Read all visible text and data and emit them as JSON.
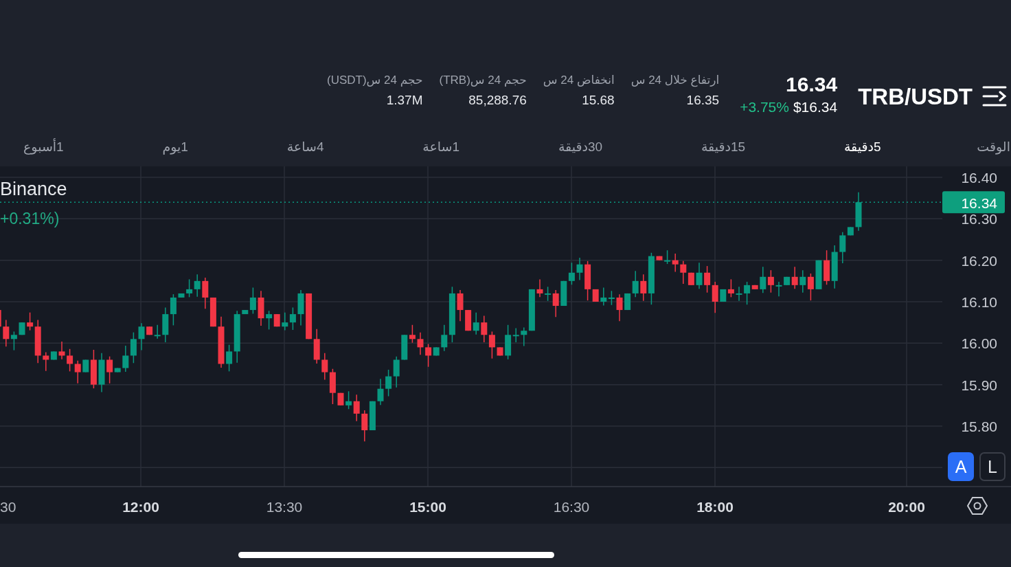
{
  "header": {
    "pair": "TRB/USDT",
    "last_price": "16.34",
    "usd_price": "$16.34",
    "change": "+3.75%",
    "stats": [
      {
        "label": "ارتفاع خلال 24 س",
        "value": "16.35"
      },
      {
        "label": "انخفاض 24 س",
        "value": "15.68"
      },
      {
        "label": "حجم 24 س(TRB)",
        "value": "85,288.76"
      },
      {
        "label": "حجم 24 س(USDT)",
        "value": "1.37M"
      }
    ]
  },
  "interval_label": "الوقت",
  "intervals": [
    {
      "label": "5دقيقة",
      "selected": true
    },
    {
      "label": "15دقيقة",
      "selected": false
    },
    {
      "label": "30دقيقة",
      "selected": false
    },
    {
      "label": "1ساعة",
      "selected": false
    },
    {
      "label": "4ساعة",
      "selected": false
    },
    {
      "label": "1يوم",
      "selected": false
    },
    {
      "label": "1أسبوع",
      "selected": false
    }
  ],
  "chart": {
    "exchange": "Binance",
    "change": "+0.31%)",
    "current_price": "16.34",
    "price_labels": [
      "16.40",
      "16.30",
      "16.20",
      "16.10",
      "16.00",
      "15.90",
      "15.80"
    ],
    "time_labels": [
      {
        "label": "20:00",
        "major": true
      },
      {
        "label": "18:00",
        "major": true
      },
      {
        "label": "16:30",
        "major": false
      },
      {
        "label": "15:00",
        "major": true
      },
      {
        "label": "13:30",
        "major": false
      },
      {
        "label": "12:00",
        "major": true
      },
      {
        "label": "30",
        "major": false
      }
    ],
    "scale_modes": [
      {
        "label": "L",
        "selected": false
      },
      {
        "label": "A",
        "selected": true
      }
    ]
  }
}
